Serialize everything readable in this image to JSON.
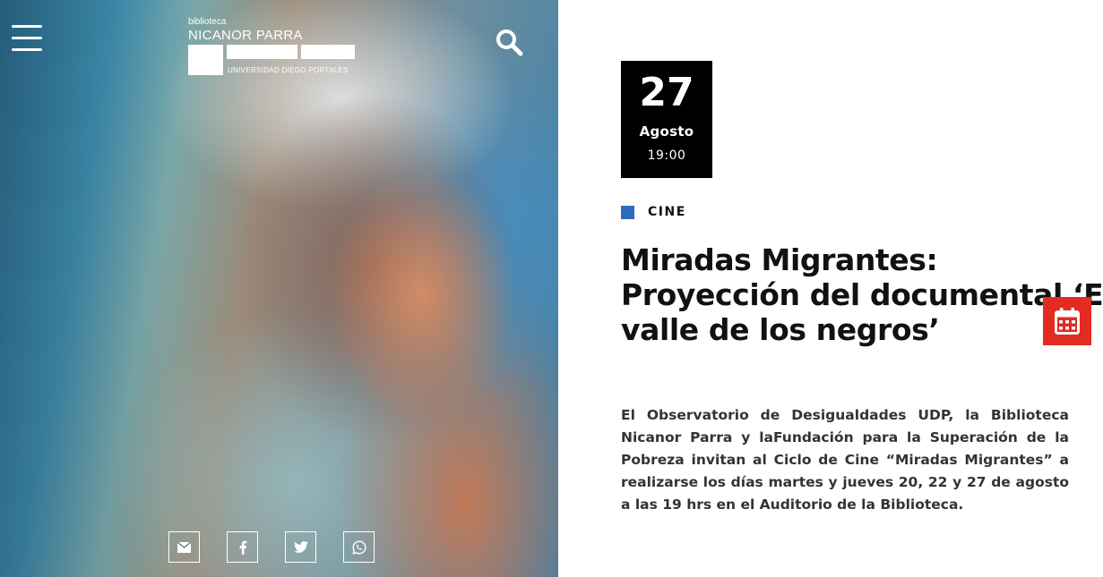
{
  "header": {
    "logo": {
      "small": "biblioteca",
      "name": "NICANOR PARRA",
      "university": "UNIVERSIDAD DIEGO PORTALES"
    }
  },
  "hero": {
    "image": "woman-portrait-photo"
  },
  "share": {
    "icons": [
      "envelope-icon",
      "facebook-icon",
      "twitter-icon",
      "whatsapp-icon"
    ]
  },
  "event": {
    "day": "27",
    "month": "Agosto",
    "time": "19:00",
    "category": "CINE",
    "category_color": "#2d6cbf",
    "title": "Miradas Migrantes: Proyección del documental ‘El valle de los negros’",
    "description": "El Observatorio de Desigualdades UDP, la Biblioteca Nicanor Parra y laFundación para la Superación de la Pobreza invitan al Ciclo de Cine “Miradas Migrantes” a realizarse los días martes y jueves 20, 22 y 27 de agosto a las 19 hrs en el Auditorio de la Biblioteca."
  },
  "calendar_button": {
    "icon": "calendar-icon",
    "color": "#e32b22"
  }
}
